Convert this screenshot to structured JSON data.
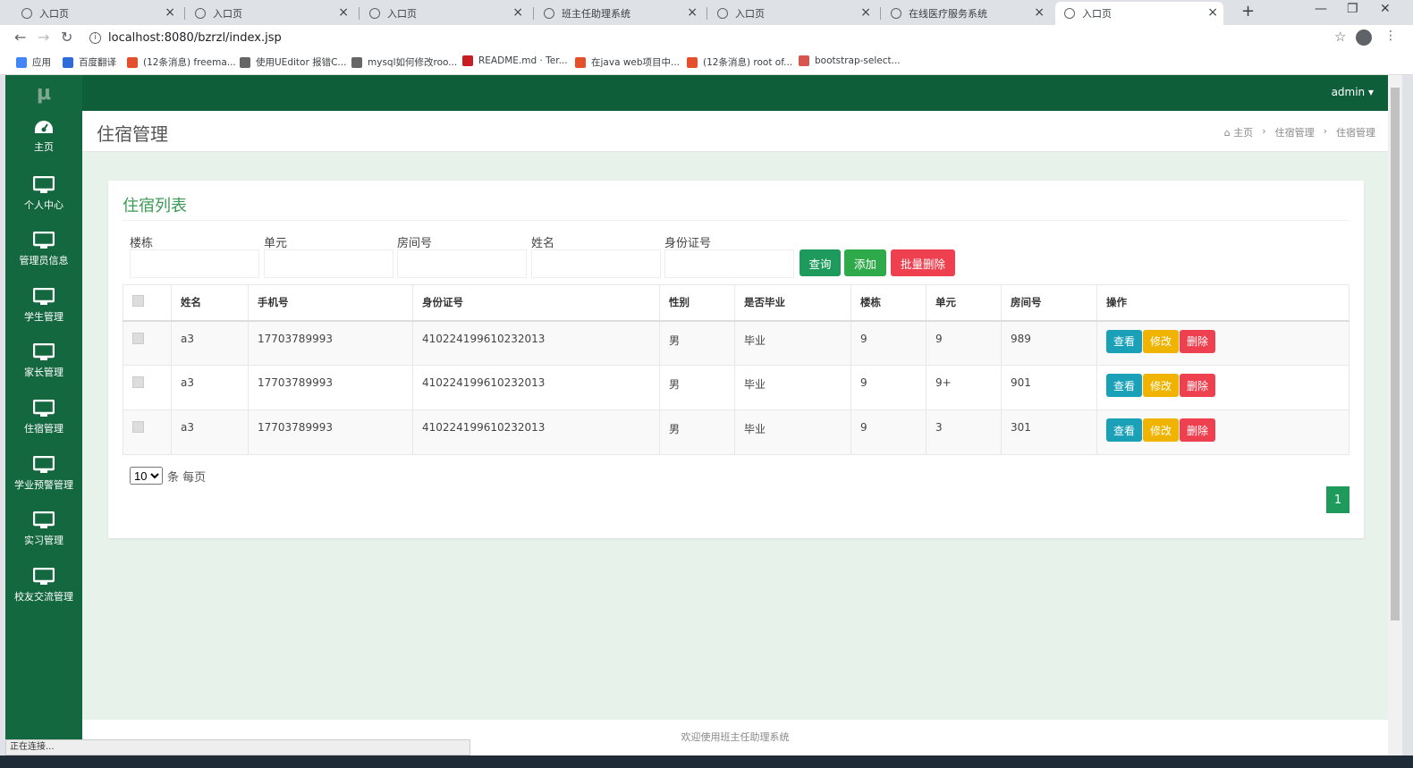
{
  "browser": {
    "tabs": [
      {
        "title": "入口页"
      },
      {
        "title": "入口页"
      },
      {
        "title": "入口页"
      },
      {
        "title": "班主任助理系统"
      },
      {
        "title": "入口页"
      },
      {
        "title": "在线医疗服务系统"
      },
      {
        "title": "入口页",
        "active": true
      }
    ],
    "url": "localhost:8080/bzrzl/index.jsp",
    "bookmarks": [
      {
        "label": "应用",
        "icon": "apps-icon",
        "color": "#4285f4"
      },
      {
        "label": "百度翻译",
        "icon": "baidu-translate-icon",
        "color": "#2f6bd8"
      },
      {
        "label": "(12条消息) freema...",
        "icon": "csdn-icon",
        "color": "#e4502c"
      },
      {
        "label": "使用UEditor 报错C...",
        "icon": "logo-icon",
        "color": "#666666"
      },
      {
        "label": "mysql如何修改roo...",
        "icon": "logo-icon",
        "color": "#666666"
      },
      {
        "label": "README.md · Ter...",
        "icon": "gitee-icon",
        "color": "#c71d23"
      },
      {
        "label": "在java web项目中...",
        "icon": "csdn-icon",
        "color": "#e4502c"
      },
      {
        "label": "(12条消息) root of...",
        "icon": "csdn-icon",
        "color": "#e4502c"
      },
      {
        "label": "bootstrap-select...",
        "icon": "bookmark-icon",
        "color": "#d9534f"
      }
    ],
    "status_text": "正在连接..."
  },
  "app": {
    "logo": "μ",
    "user": "admin ▾",
    "sidebar": [
      {
        "label": "主页",
        "icon": "dashboard-icon"
      },
      {
        "label": "个人中心",
        "icon": "monitor-icon"
      },
      {
        "label": "管理员信息",
        "icon": "monitor-icon"
      },
      {
        "label": "学生管理",
        "icon": "monitor-icon"
      },
      {
        "label": "家长管理",
        "icon": "monitor-icon"
      },
      {
        "label": "住宿管理",
        "icon": "monitor-icon"
      },
      {
        "label": "学业预警管理",
        "icon": "monitor-icon"
      },
      {
        "label": "实习管理",
        "icon": "monitor-icon"
      },
      {
        "label": "校友交流管理",
        "icon": "monitor-icon"
      }
    ],
    "page_title": "住宿管理",
    "breadcrumb": [
      "主页",
      "住宿管理",
      "住宿管理"
    ],
    "card_title": "住宿列表",
    "filters": [
      {
        "label": "楼栋",
        "value": ""
      },
      {
        "label": "单元",
        "value": ""
      },
      {
        "label": "房间号",
        "value": ""
      },
      {
        "label": "姓名",
        "value": ""
      },
      {
        "label": "身份证号",
        "value": ""
      }
    ],
    "buttons": {
      "query": "查询",
      "add": "添加",
      "batch_delete": "批量删除"
    },
    "colors": {
      "green": "#1e9a5c",
      "add": "#2eaa4a",
      "red": "#ef4050",
      "cyan": "#1aa1b8",
      "yellow": "#f0b400"
    },
    "table": {
      "headers": [
        "姓名",
        "手机号",
        "身份证号",
        "性别",
        "是否毕业",
        "楼栋",
        "单元",
        "房间号",
        "操作"
      ],
      "rows": [
        [
          "a3",
          "17703789993",
          "410224199610232013",
          "男",
          "毕业",
          "9",
          "9",
          "989"
        ],
        [
          "a3",
          "17703789993",
          "410224199610232013",
          "男",
          "毕业",
          "9",
          "9+",
          "901"
        ],
        [
          "a3",
          "17703789993",
          "410224199610232013",
          "男",
          "毕业",
          "9",
          "3",
          "301"
        ]
      ],
      "actions": {
        "view": "查看",
        "edit": "修改",
        "delete": "删除"
      }
    },
    "pagination": {
      "page_size": "10",
      "page_size_suffix": "条 每页",
      "current_page": "1"
    },
    "footer": "欢迎使用班主任助理系统"
  }
}
